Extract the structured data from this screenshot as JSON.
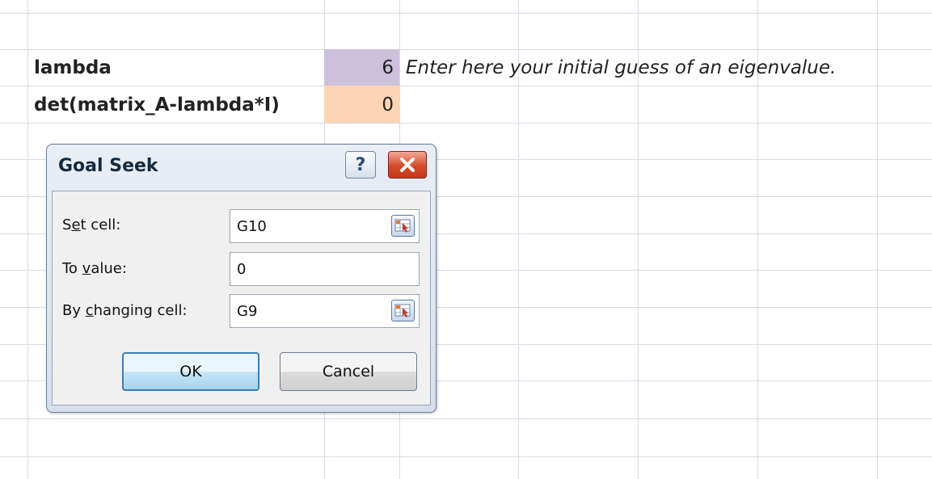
{
  "sheet": {
    "row_lambda": {
      "label": "lambda",
      "value": "6",
      "note": "Enter here your initial guess of an eigenvalue."
    },
    "row_det": {
      "label": "det(matrix_A-lambda*I)",
      "value": "0"
    },
    "colors": {
      "lambda_fill": "#ccc0da",
      "det_fill": "#fcd5b4",
      "gridline": "#d6dbe3"
    }
  },
  "dialog": {
    "title": "Goal Seek",
    "help_label": "?",
    "set_cell": {
      "label_pre": "S",
      "label_acc": "e",
      "label_post": "t cell:",
      "value": "G10"
    },
    "to_value": {
      "label_pre": "To ",
      "label_acc": "v",
      "label_post": "alue:",
      "value": "0"
    },
    "changing_cell": {
      "label_pre": "By ",
      "label_acc": "c",
      "label_post": "hanging cell:",
      "value": "G9"
    },
    "ok_label": "OK",
    "cancel_label": "Cancel"
  }
}
